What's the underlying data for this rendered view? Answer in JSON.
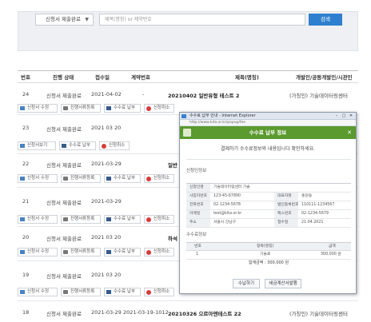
{
  "search": {
    "select_value": "신청서 제출완료",
    "placeholder": "제목(명칭) or 제약번호",
    "button_label": "검색"
  },
  "table": {
    "headers": [
      "번호",
      "진행 상태",
      "접수일",
      "계약번호",
      "제목(명칭)",
      "개발인/공동개발인/시관인"
    ],
    "rows": [
      {
        "no": "24",
        "status": "신청서 제출완료",
        "date": "2021-04-02",
        "contract": "-",
        "title": "20210402 일반유형 테스트 2",
        "dev": "(가칭인) 기술데이터링센터",
        "actions": [
          "신청서 수정",
          "진행서류등록",
          "수수료 납부",
          "신청취소"
        ]
      },
      {
        "no": "23",
        "status": "신청서 제출완료",
        "date": "2021 03 20",
        "contract": "",
        "title": "",
        "dev": "",
        "actions": [
          "신청서보기",
          "수수료 납부",
          "신청취소"
        ]
      },
      {
        "no": "22",
        "status": "신청서 제출완료",
        "date": "2021-03-29",
        "contract": "",
        "title": "일반",
        "dev": "",
        "actions": [
          "신청서 수정",
          "진행서류등록",
          "수수료 납부",
          "신청취소"
        ]
      },
      {
        "no": "21",
        "status": "신청서 제출완료",
        "date": "2021-03-29",
        "contract": "",
        "title": "",
        "dev": "",
        "actions": [
          "신청서 수정",
          "진행서류등록",
          "수수료 납부",
          "신청취소"
        ]
      },
      {
        "no": "20",
        "status": "신청서 제출완료",
        "date": "2021 03 20",
        "contract": "",
        "title": "하석",
        "dev": "",
        "actions": [
          "신청서 수정",
          "진행서류등록",
          "수수료 납부",
          "신청취소"
        ]
      },
      {
        "no": "19",
        "status": "신청서 제출완료",
        "date": "2021 03 20",
        "contract": "",
        "title": "",
        "dev": "",
        "actions": [
          "신청서 수정",
          "진행서류등록",
          "수수료 납부",
          "신청취소"
        ]
      },
      {
        "no": "18",
        "status": "신청서 제출완료",
        "date": "2021-03-29",
        "contract": "2021-03-19-1012",
        "title": "20210326 으르아앤테스트 22",
        "dev": "(가칭인) 기술데이터링센터",
        "actions": []
      }
    ]
  },
  "popup": {
    "window_title": "수수료 납부 안내 - Internet Explorer",
    "url": "http://www.kita.or.kr/popup/fee",
    "header_title": "수수료 납부 정보",
    "close_label": "✕",
    "notice": "결제하기 수수료정보와 내용입니다 확인하세요.",
    "section_applicant": "신청인정보",
    "applicant": {
      "name_label": "신청인명",
      "name_value": "기술데이터링센터 기술",
      "biz_label": "사업자번호",
      "biz_value": "123-45-67890",
      "rep_label": "대표자명",
      "rep_value": "홍길동",
      "tel_label": "전화번호",
      "tel_value": "02-1234-5678",
      "email_label": "이메일",
      "email_value": "test@kita.or.kr",
      "reg_label": "법인등록번호",
      "reg_value": "110111-1234567",
      "fax_label": "팩스번호",
      "fax_value": "02-1234-5679",
      "addr_label": "주소",
      "addr_value": "서울시 강남구",
      "date_label": "접수일",
      "date_value": "21.04.2021"
    },
    "section_fee": "수수료정보",
    "fee_headers": [
      "번호",
      "항목(명칭)",
      "금액"
    ],
    "fee_row": {
      "no": "1",
      "item": "기술료",
      "amount": "300,000 원"
    },
    "total_label": "합계금액 : 300,000 원",
    "pay_button": "수납하기",
    "invoice_button": "세금계산서발행"
  }
}
